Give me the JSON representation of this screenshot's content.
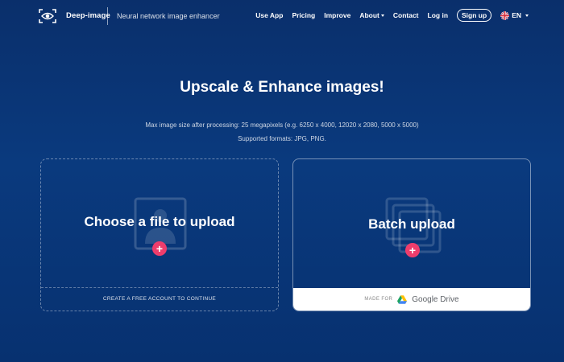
{
  "nav": {
    "logo_text": "Deep-image",
    "tagline": "Neural network image enhancer",
    "links": [
      "Use App",
      "Pricing",
      "Improve",
      "About",
      "Contact",
      "Log in"
    ],
    "signup_label": "Sign up",
    "language": "EN"
  },
  "hero": {
    "title": "Upscale & Enhance images!",
    "max_size_text": "Max image size after processing: 25 megapixels (e.g. 6250 x 4000, 12020 x 2080, 5000 x 5000)",
    "formats_text": "Supported formats: JPG, PNG."
  },
  "upload_card": {
    "title": "Choose a file to upload",
    "footer": "CREATE A FREE ACCOUNT TO CONTINUE",
    "icon": "image-icon"
  },
  "batch_card": {
    "title": "Batch upload",
    "made_for": "MADE FOR",
    "drive_label": "Google Drive",
    "icon": "stacked-images-icon"
  },
  "colors": {
    "background": "#0a3a7e",
    "accent_plus": "#ee3d6c",
    "text": "#ffffff"
  }
}
